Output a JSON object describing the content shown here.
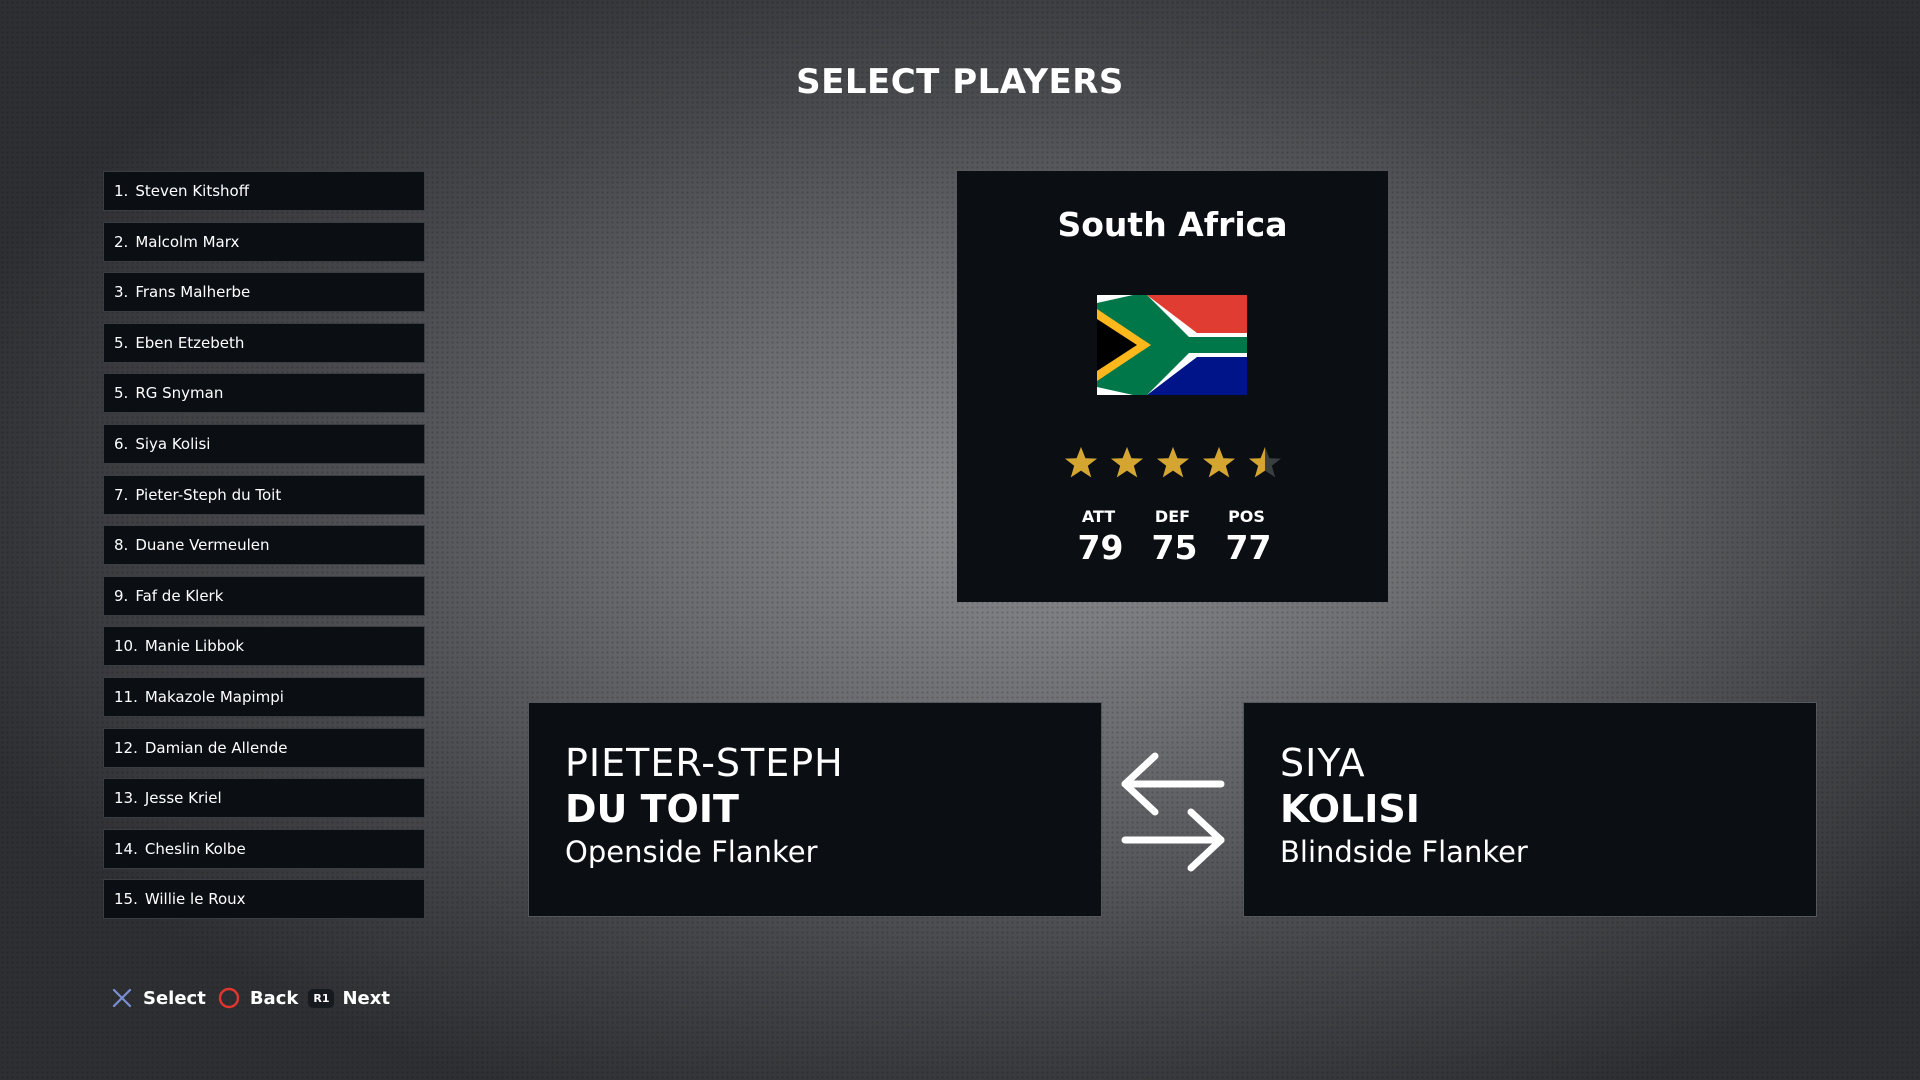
{
  "screen": {
    "title": "SELECT PLAYERS"
  },
  "roster": [
    {
      "num": "1.",
      "name": "Steven Kitshoff"
    },
    {
      "num": "2.",
      "name": "Malcolm Marx"
    },
    {
      "num": "3.",
      "name": "Frans Malherbe"
    },
    {
      "num": "5.",
      "name": "Eben Etzebeth"
    },
    {
      "num": "5.",
      "name": "RG Snyman"
    },
    {
      "num": "6.",
      "name": "Siya Kolisi"
    },
    {
      "num": "7.",
      "name": "Pieter-Steph du Toit"
    },
    {
      "num": "8.",
      "name": "Duane Vermeulen"
    },
    {
      "num": "9.",
      "name": "Faf de Klerk"
    },
    {
      "num": "10.",
      "name": "Manie Libbok"
    },
    {
      "num": "11.",
      "name": "Makazole Mapimpi"
    },
    {
      "num": "12.",
      "name": "Damian de Allende"
    },
    {
      "num": "13.",
      "name": "Jesse Kriel"
    },
    {
      "num": "14.",
      "name": "Cheslin Kolbe"
    },
    {
      "num": "15.",
      "name": "Willie le Roux"
    }
  ],
  "team": {
    "name": "South Africa",
    "flag_icon": "south-africa-flag",
    "rating_stars": 4.5,
    "stats": [
      {
        "label": "ATT",
        "value": "79"
      },
      {
        "label": "DEF",
        "value": "75"
      },
      {
        "label": "POS",
        "value": "77"
      }
    ]
  },
  "swap": {
    "left": {
      "first": "PIETER-STEPH",
      "last": "DU TOIT",
      "position": "Openside Flanker"
    },
    "right": {
      "first": "SIYA",
      "last": "KOLISI",
      "position": "Blindside Flanker"
    },
    "icon": "swap-arrows-icon"
  },
  "hints": {
    "select": {
      "icon": "cross-button-icon",
      "label": "Select"
    },
    "back": {
      "icon": "circle-button-icon",
      "label": "Back"
    },
    "next": {
      "badge": "R1",
      "label": "Next"
    }
  },
  "colors": {
    "panel": "#0b0f14",
    "star": "#d4a631",
    "cross": "#7b8fd6",
    "circle": "#e0362f"
  }
}
